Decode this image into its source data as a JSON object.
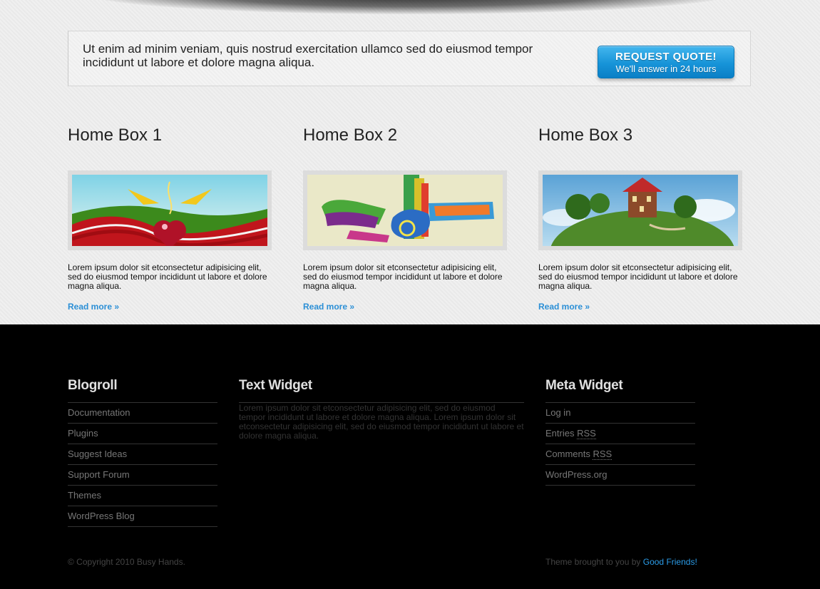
{
  "quote": {
    "text": "Ut enim ad minim veniam, quis nostrud exercitation ullamco sed do eiusmod tempor incididunt ut labore et dolore magna aliqua.",
    "button_line1": "REQUEST QUOTE!",
    "button_line2": "We'll answer in 24 hours"
  },
  "boxes": [
    {
      "title": "Home Box 1",
      "text": "Lorem ipsum dolor sit etconsectetur adipisicing elit, sed do eiusmod tempor incididunt ut labore et dolore magna aliqua.",
      "link": "Read more »"
    },
    {
      "title": "Home Box 2",
      "text": "Lorem ipsum dolor sit etconsectetur adipisicing elit, sed do eiusmod tempor incididunt ut labore et dolore magna aliqua.",
      "link": "Read more »"
    },
    {
      "title": "Home Box 3",
      "text": "Lorem ipsum dolor sit etconsectetur adipisicing elit, sed do eiusmod tempor incididunt ut labore et dolore magna aliqua.",
      "link": "Read more »"
    }
  ],
  "footer": {
    "blogroll": {
      "title": "Blogroll",
      "items": [
        "Documentation",
        "Plugins",
        "Suggest Ideas",
        "Support Forum",
        "Themes",
        "WordPress Blog"
      ]
    },
    "text_widget": {
      "title": "Text Widget",
      "body": "Lorem ipsum dolor sit etconsectetur adipisicing elit, sed do eiusmod tempor incididunt ut labore et dolore magna aliqua. Lorem ipsum dolor sit etconsectetur adipisicing elit, sed do eiusmod tempor incididunt ut labore et dolore magna aliqua."
    },
    "meta": {
      "title": "Meta Widget",
      "items": [
        {
          "text": "Log in",
          "abbr": ""
        },
        {
          "text": "Entries ",
          "abbr": "RSS"
        },
        {
          "text": "Comments ",
          "abbr": "RSS"
        },
        {
          "text": "WordPress.org",
          "abbr": ""
        }
      ]
    },
    "copyright": "© Copyright 2010 Busy Hands.",
    "credit_text": "Theme brought to you by ",
    "credit_link": "Good Friends!"
  },
  "colors": {
    "accent": "#2b8fd6",
    "button": "#1794d8",
    "footer_bg": "#000000",
    "page_bg": "#ededed"
  }
}
